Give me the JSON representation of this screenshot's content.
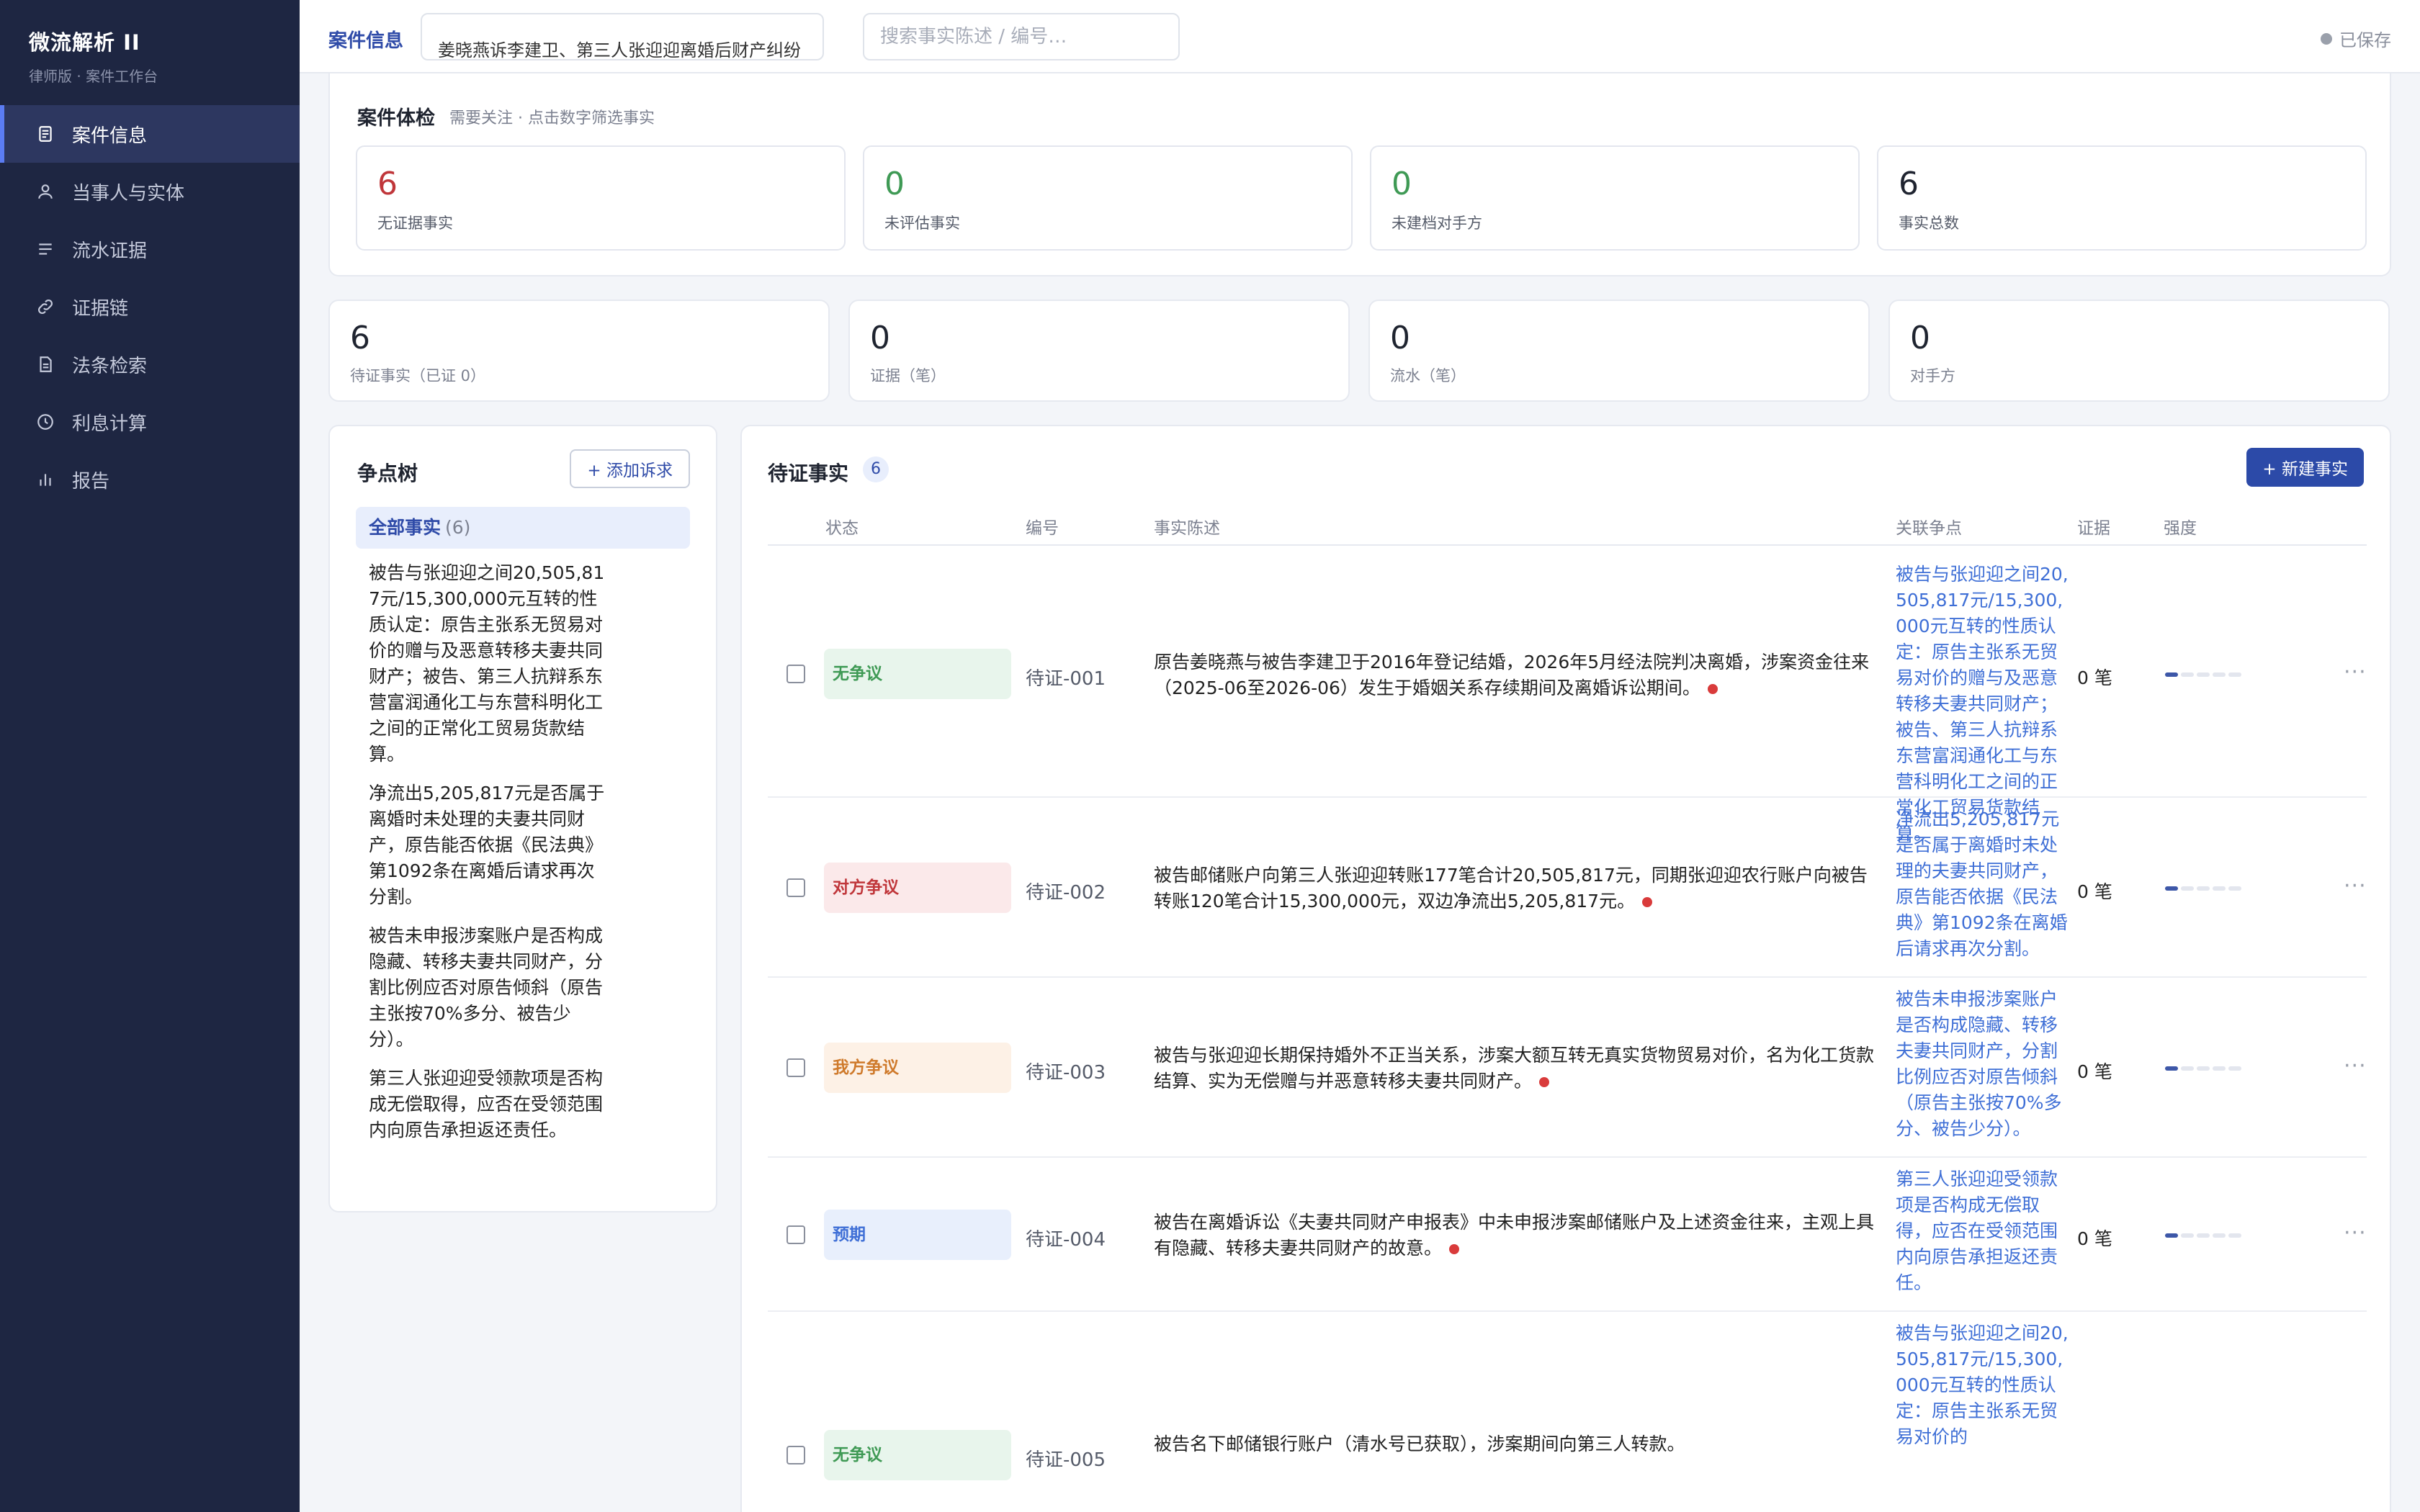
{
  "app": {
    "title": "微流解析 II",
    "subtitle": "律师版 · 案件工作台"
  },
  "nav": [
    {
      "label": "案件信息",
      "icon": "document-icon",
      "active": true
    },
    {
      "label": "当事人与实体",
      "icon": "user-icon",
      "active": false
    },
    {
      "label": "流水证据",
      "icon": "list-icon",
      "active": false
    },
    {
      "label": "证据链",
      "icon": "link-icon",
      "active": false
    },
    {
      "label": "法条检索",
      "icon": "file-icon",
      "active": false
    },
    {
      "label": "利息计算",
      "icon": "clock-icon",
      "active": false
    },
    {
      "label": "报告",
      "icon": "bar-chart-icon",
      "active": false
    }
  ],
  "topbar": {
    "title": "案件信息",
    "case_name": "姜晓燕诉李建卫、第三人张迎迎离婚后财产纠纷",
    "search_placeholder": "搜索事实陈述 / 编号…",
    "saved_label": "已保存"
  },
  "health": {
    "title": "案件体检",
    "hint": "需要关注 · 点击数字筛选事实",
    "cards": [
      {
        "value": "6",
        "label": "无证据事实",
        "tone": "red"
      },
      {
        "value": "0",
        "label": "未评估事实",
        "tone": "green"
      },
      {
        "value": "0",
        "label": "未建档对手方",
        "tone": "green"
      },
      {
        "value": "6",
        "label": "事实总数",
        "tone": "dark"
      }
    ]
  },
  "stats": [
    {
      "value": "6",
      "label": "待证事实（已证 0）"
    },
    {
      "value": "0",
      "label": "证据（笔）"
    },
    {
      "value": "0",
      "label": "流水（笔）"
    },
    {
      "value": "0",
      "label": "对手方"
    }
  ],
  "issue_tree": {
    "title": "争点树",
    "add_button": "+ 添加诉求",
    "all_label": "全部事实",
    "all_count": "(6)",
    "issues": [
      "被告与张迎迎之间20,505,817元/15,300,000元互转的性质认定：原告主张系无贸易对价的赠与及恶意转移夫妻共同财产；被告、第三人抗辩系东营富润通化工与东营科明化工之间的正常化工贸易货款结算。",
      "净流出5,205,817元是否属于离婚时未处理的夫妻共同财产，原告能否依据《民法典》第1092条在离婚后请求再次分割。",
      "被告未申报涉案账户是否构成隐藏、转移夫妻共同财产，分割比例应否对原告倾斜（原告主张按70%多分、被告少分）。",
      "第三人张迎迎受领款项是否构成无偿取得，应否在受领范围内向原告承担返还责任。"
    ]
  },
  "facts": {
    "title": "待证事实",
    "count": "6",
    "new_button": "+ 新建事实",
    "columns": [
      "状态",
      "编号",
      "事实陈述",
      "关联争点",
      "证据",
      "强度"
    ],
    "rows": [
      {
        "status": "无争议",
        "tone": "green",
        "id": "待证-001",
        "desc": "原告姜晓燕与被告李建卫于2016年登记结婚，2026年5月经法院判决离婚，涉案资金往来（2025-06至2026-06）发生于婚姻关系存续期间及离婚诉讼期间。",
        "issue": "被告与张迎迎之间20,505,817元/15,300,000元互转的性质认定：原告主张系无贸易对价的赠与及恶意转移夫妻共同财产；被告、第三人抗辩系东营富润通化工与东营科明化工之间的正常化工贸易货款结算。",
        "evidence": "0 笔",
        "strength": 1
      },
      {
        "status": "对方争议",
        "tone": "red",
        "id": "待证-002",
        "desc": "被告邮储账户向第三人张迎迎转账177笔合计20,505,817元，同期张迎迎农行账户向被告转账120笔合计15,300,000元，双边净流出5,205,817元。",
        "issue": "净流出5,205,817元是否属于离婚时未处理的夫妻共同财产，原告能否依据《民法典》第1092条在离婚后请求再次分割。",
        "evidence": "0 笔",
        "strength": 1
      },
      {
        "status": "我方争议",
        "tone": "orange",
        "id": "待证-003",
        "desc": "被告与张迎迎长期保持婚外不正当关系，涉案大额互转无真实货物贸易对价，名为化工货款结算、实为无偿赠与并恶意转移夫妻共同财产。",
        "issue": "被告未申报涉案账户是否构成隐藏、转移夫妻共同财产，分割比例应否对原告倾斜（原告主张按70%多分、被告少分）。",
        "evidence": "0 笔",
        "strength": 1
      },
      {
        "status": "预期",
        "tone": "blue",
        "id": "待证-004",
        "desc": "被告在离婚诉讼《夫妻共同财产申报表》中未申报涉案邮储账户及上述资金往来，主观上具有隐藏、转移夫妻共同财产的故意。",
        "issue": "第三人张迎迎受领款项是否构成无偿取得，应否在受领范围内向原告承担返还责任。",
        "evidence": "0 笔",
        "strength": 1
      },
      {
        "status": "无争议",
        "tone": "green",
        "id": "待证-005",
        "desc": "被告名下邮储银行账户（清水号已获取），涉案期间向第三人转款。",
        "issue": "被告与张迎迎之间20,505,817元/15,300,000元互转的性质认定：原告主张系无贸易对价的",
        "evidence": "0 笔",
        "strength": 1
      }
    ]
  }
}
